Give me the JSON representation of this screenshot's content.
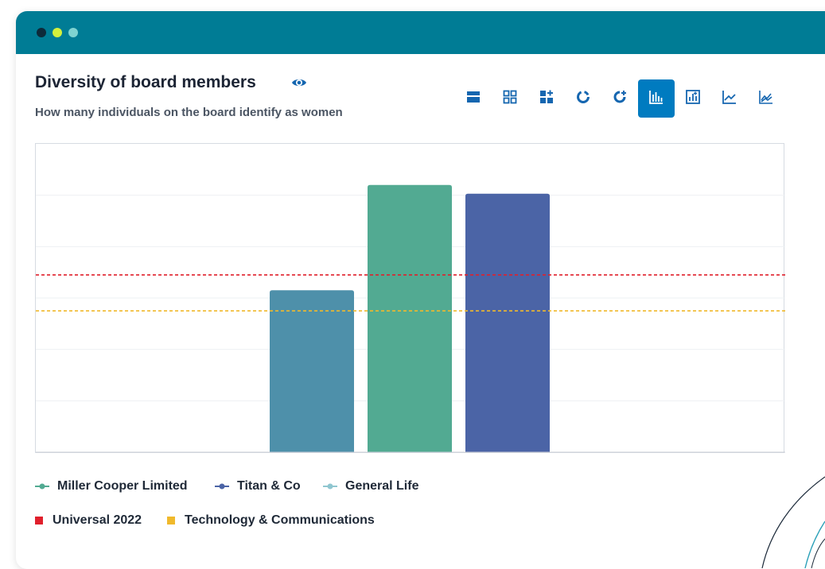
{
  "window": {
    "dots": [
      {
        "color": "#0d2a3a"
      },
      {
        "color": "#d4f03c"
      },
      {
        "color": "#7fd3d1"
      }
    ]
  },
  "widget": {
    "title": "Diversity of board members",
    "subtitle": "How many individuals on the board identify as women",
    "view_icon": "eye-icon"
  },
  "toolbar": {
    "buttons": [
      {
        "icon": "single-panel-icon",
        "active": false
      },
      {
        "icon": "grid-icon",
        "active": false
      },
      {
        "icon": "grid-add-icon",
        "active": false
      },
      {
        "icon": "donut-chart-icon",
        "active": false
      },
      {
        "icon": "donut-add-icon",
        "active": false
      },
      {
        "icon": "bar-chart-icon",
        "active": true
      },
      {
        "icon": "bar-chart-add-icon",
        "active": false
      },
      {
        "icon": "line-chart-icon",
        "active": false
      },
      {
        "icon": "line-chart-multi-icon",
        "active": false
      }
    ],
    "accent": "#007bc0",
    "icon_color": "#1566b0"
  },
  "chart_data": {
    "type": "bar",
    "title": "",
    "xlabel": "",
    "ylabel": "",
    "ylim": [
      0,
      6
    ],
    "grid": true,
    "categories": [
      "",
      "",
      ""
    ],
    "bars": [
      {
        "value": 3.15,
        "color": "#4e90aa"
      },
      {
        "value": 5.2,
        "color": "#52aa92"
      },
      {
        "value": 5.03,
        "color": "#4b64a6"
      }
    ],
    "reference_lines": [
      {
        "name": "Universal 2022",
        "value": 3.45,
        "color": "#e0202c",
        "style": "dashed"
      },
      {
        "name": "Technology & Communications",
        "value": 2.75,
        "color": "#f0b92c",
        "style": "dashed"
      }
    ],
    "legend": [
      {
        "name": "Miller Cooper Limited",
        "color": "#52aa92",
        "marker": "line-dot"
      },
      {
        "name": "Titan & Co",
        "color": "#4b64a6",
        "marker": "line-dot"
      },
      {
        "name": "General Life",
        "color": "#8fc6d0",
        "marker": "line-dot"
      },
      {
        "name": "Universal 2022",
        "color": "#e0202c",
        "marker": "square"
      },
      {
        "name": "Technology & Communications",
        "color": "#f0b92c",
        "marker": "square"
      }
    ]
  }
}
